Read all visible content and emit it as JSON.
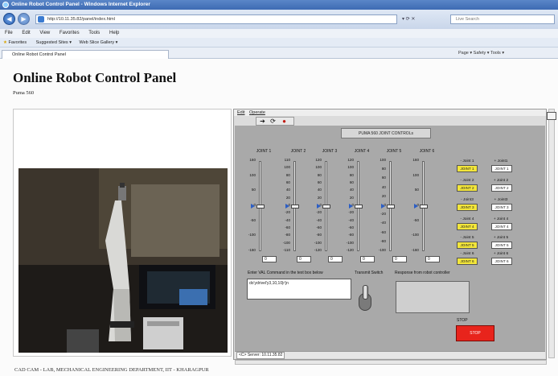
{
  "browser": {
    "window_title": "Online Robot Control Panel - Windows Internet Explorer",
    "address": "http://10.11.35.82/panel/index.html",
    "search_placeholder": "Live Search",
    "menu": [
      "File",
      "Edit",
      "View",
      "Favorites",
      "Tools",
      "Help"
    ],
    "favorites_label": "Favorites",
    "fav_links": [
      "Suggested Sites ▾",
      "Web Slice Gallery ▾"
    ],
    "tab_title": "Online Robot Control Panel",
    "tab_tools": "Page ▾  Safety ▾  Tools ▾",
    "back_glyph": "◀",
    "forward_glyph": "▶",
    "addr_tools": "▾  ⟳  ✕"
  },
  "page": {
    "title": "Online Robot Control Panel",
    "subtitle": "Puma 560",
    "footer": "CAD CAM - LAB, MECHANICAL ENGINEERING DEPARTMENT, IIT - KHARAGPUR"
  },
  "applet": {
    "menu": [
      "Edit",
      "Operate"
    ],
    "toolbar_icons": [
      "run-arrow-icon",
      "run-continuous-icon",
      "abort-icon"
    ],
    "toolbar_glyphs": [
      "➔",
      "⟳",
      "●"
    ],
    "panel_title": "PUMA 560 JOINT CONTROLs",
    "sliders": [
      {
        "label": "JOINT 1",
        "ticks": [
          "160",
          "",
          "100",
          "",
          "50",
          "",
          "0",
          "",
          "-50",
          "",
          "-100",
          "",
          "-160"
        ],
        "value": "0"
      },
      {
        "label": "JOINT 2",
        "ticks": [
          "110",
          "100",
          "80",
          "60",
          "40",
          "20",
          "0",
          "-20",
          "-40",
          "-60",
          "-80",
          "-100",
          "-110"
        ],
        "value": "0"
      },
      {
        "label": "JOINT 3",
        "ticks": [
          "120",
          "100",
          "80",
          "60",
          "40",
          "20",
          "0",
          "-20",
          "-40",
          "-60",
          "-80",
          "-100",
          "-120"
        ],
        "value": "0"
      },
      {
        "label": "JOINT 4",
        "ticks": [
          "120",
          "100",
          "80",
          "60",
          "40",
          "20",
          "0",
          "-20",
          "-40",
          "-60",
          "-80",
          "-100",
          "-120"
        ],
        "value": "0"
      },
      {
        "label": "JOINT 5",
        "ticks": [
          "100",
          "80",
          "60",
          "40",
          "20",
          "0",
          "-20",
          "-40",
          "-60",
          "-80",
          "-100"
        ],
        "value": "0"
      },
      {
        "label": "JOINT 6",
        "ticks": [
          "160",
          "",
          "100",
          "",
          "50",
          "",
          "0",
          "",
          "-50",
          "",
          "-100",
          "",
          "-160"
        ],
        "value": "0"
      }
    ],
    "joint_minus": [
      {
        "label": "- Joint 1",
        "button": "JOINT 1"
      },
      {
        "label": "- Joint 2",
        "button": "JOINT 2"
      },
      {
        "label": "- Joint3",
        "button": "JOINT 3"
      },
      {
        "label": "- Joint 4",
        "button": "JOINT 4"
      },
      {
        "label": "- Joint 5",
        "button": "JOINT 5"
      },
      {
        "label": "- Joint 6",
        "button": "JOINT 6"
      }
    ],
    "joint_plus": [
      {
        "label": "+ Joint1",
        "button": "JOINT 1"
      },
      {
        "label": "+ Joint 2",
        "button": "JOINT 2"
      },
      {
        "label": "+ Joint3",
        "button": "JOINT 3"
      },
      {
        "label": "+ Joint 4",
        "button": "JOINT 4"
      },
      {
        "label": "+ Joint 5",
        "button": "JOINT 5"
      },
      {
        "label": "+ Joint 6",
        "button": "JOINT 6"
      }
    ],
    "command_label": "Enter VAL Command in the text box below",
    "command_value": "do'ydrivel'y3,10,10|r'jn",
    "transmit_label": "Transmit Switch",
    "response_label": "Response from robot controller",
    "stop_label": "STOP",
    "stop_button": "STOP",
    "status_text": "<C> Server: 10.11.35.82"
  },
  "colors": {
    "joint_button_active": "#f3e63a",
    "stop_button": "#e8241c",
    "panel_bg": "#a9a9a9"
  }
}
